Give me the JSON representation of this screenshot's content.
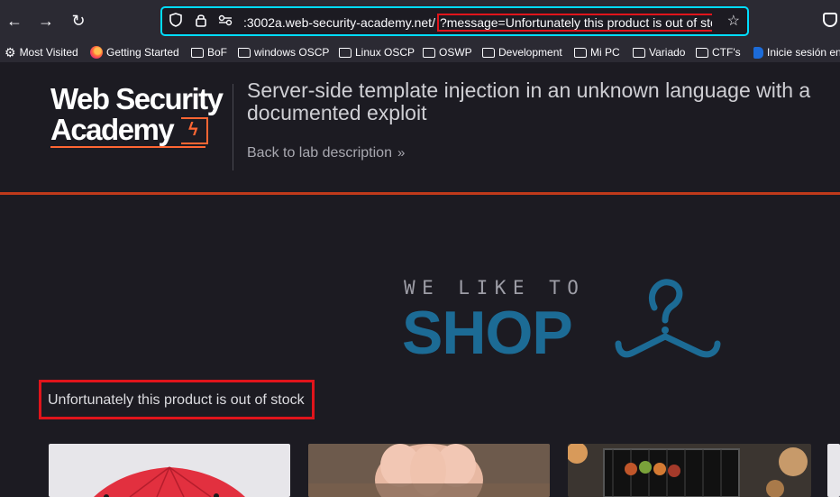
{
  "browser": {
    "url": {
      "host_text": ":3002a.web-security-academy.net/",
      "query_text": "?message=Unfortunately this product is out of stock"
    },
    "icons": {
      "back": "back-arrow-icon",
      "forward": "forward-arrow-icon",
      "reload": "reload-icon",
      "tracking": "shield-icon",
      "lock": "lock-icon",
      "permissions": "permissions-icon",
      "bookmark": "star-icon",
      "pocket": "pocket-icon"
    },
    "bookmarks": [
      {
        "label": "Most Visited",
        "icon": "gear-icon"
      },
      {
        "label": "Getting Started",
        "icon": "firefox-icon"
      },
      {
        "label": "BoF",
        "icon": "folder-icon"
      },
      {
        "label": "windows OSCP",
        "icon": "folder-icon"
      },
      {
        "label": "Linux OSCP",
        "icon": "folder-icon"
      },
      {
        "label": "OSWP",
        "icon": "folder-icon"
      },
      {
        "label": "Development",
        "icon": "folder-icon"
      },
      {
        "label": "Mi PC",
        "icon": "folder-icon"
      },
      {
        "label": "Variado",
        "icon": "folder-icon"
      },
      {
        "label": "CTF's",
        "icon": "folder-icon"
      },
      {
        "label": "Inicie sesión en",
        "icon": "paypal-icon"
      }
    ]
  },
  "lab": {
    "logo": {
      "line1": "Web Security",
      "line2": "Academy"
    },
    "title": "Server-side template injection in an unknown language with a documented exploit",
    "back_link": "Back to lab description",
    "back_chevron": "»"
  },
  "shop": {
    "tagline": "WE LIKE TO",
    "word": "SHOP"
  },
  "message": "Unfortunately this product is out of stock",
  "colors": {
    "accent_url": "#00ddff",
    "highlight": "#e0141b",
    "header_rule": "#bf3a1b",
    "shop_blue": "#1c6b95",
    "logo_orange": "#ff6633"
  }
}
